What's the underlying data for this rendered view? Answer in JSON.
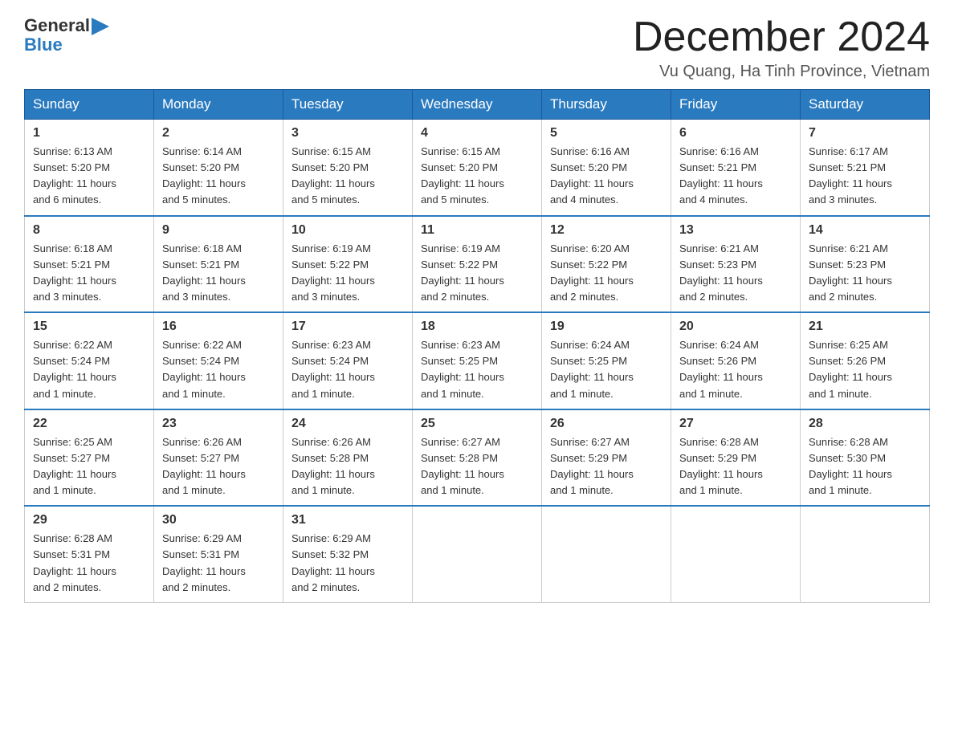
{
  "logo": {
    "text_general": "General",
    "text_blue": "Blue"
  },
  "header": {
    "month_year": "December 2024",
    "location": "Vu Quang, Ha Tinh Province, Vietnam"
  },
  "days_of_week": [
    "Sunday",
    "Monday",
    "Tuesday",
    "Wednesday",
    "Thursday",
    "Friday",
    "Saturday"
  ],
  "weeks": [
    [
      {
        "day": "1",
        "sunrise": "6:13 AM",
        "sunset": "5:20 PM",
        "daylight": "11 hours and 6 minutes."
      },
      {
        "day": "2",
        "sunrise": "6:14 AM",
        "sunset": "5:20 PM",
        "daylight": "11 hours and 5 minutes."
      },
      {
        "day": "3",
        "sunrise": "6:15 AM",
        "sunset": "5:20 PM",
        "daylight": "11 hours and 5 minutes."
      },
      {
        "day": "4",
        "sunrise": "6:15 AM",
        "sunset": "5:20 PM",
        "daylight": "11 hours and 5 minutes."
      },
      {
        "day": "5",
        "sunrise": "6:16 AM",
        "sunset": "5:20 PM",
        "daylight": "11 hours and 4 minutes."
      },
      {
        "day": "6",
        "sunrise": "6:16 AM",
        "sunset": "5:21 PM",
        "daylight": "11 hours and 4 minutes."
      },
      {
        "day": "7",
        "sunrise": "6:17 AM",
        "sunset": "5:21 PM",
        "daylight": "11 hours and 3 minutes."
      }
    ],
    [
      {
        "day": "8",
        "sunrise": "6:18 AM",
        "sunset": "5:21 PM",
        "daylight": "11 hours and 3 minutes."
      },
      {
        "day": "9",
        "sunrise": "6:18 AM",
        "sunset": "5:21 PM",
        "daylight": "11 hours and 3 minutes."
      },
      {
        "day": "10",
        "sunrise": "6:19 AM",
        "sunset": "5:22 PM",
        "daylight": "11 hours and 3 minutes."
      },
      {
        "day": "11",
        "sunrise": "6:19 AM",
        "sunset": "5:22 PM",
        "daylight": "11 hours and 2 minutes."
      },
      {
        "day": "12",
        "sunrise": "6:20 AM",
        "sunset": "5:22 PM",
        "daylight": "11 hours and 2 minutes."
      },
      {
        "day": "13",
        "sunrise": "6:21 AM",
        "sunset": "5:23 PM",
        "daylight": "11 hours and 2 minutes."
      },
      {
        "day": "14",
        "sunrise": "6:21 AM",
        "sunset": "5:23 PM",
        "daylight": "11 hours and 2 minutes."
      }
    ],
    [
      {
        "day": "15",
        "sunrise": "6:22 AM",
        "sunset": "5:24 PM",
        "daylight": "11 hours and 1 minute."
      },
      {
        "day": "16",
        "sunrise": "6:22 AM",
        "sunset": "5:24 PM",
        "daylight": "11 hours and 1 minute."
      },
      {
        "day": "17",
        "sunrise": "6:23 AM",
        "sunset": "5:24 PM",
        "daylight": "11 hours and 1 minute."
      },
      {
        "day": "18",
        "sunrise": "6:23 AM",
        "sunset": "5:25 PM",
        "daylight": "11 hours and 1 minute."
      },
      {
        "day": "19",
        "sunrise": "6:24 AM",
        "sunset": "5:25 PM",
        "daylight": "11 hours and 1 minute."
      },
      {
        "day": "20",
        "sunrise": "6:24 AM",
        "sunset": "5:26 PM",
        "daylight": "11 hours and 1 minute."
      },
      {
        "day": "21",
        "sunrise": "6:25 AM",
        "sunset": "5:26 PM",
        "daylight": "11 hours and 1 minute."
      }
    ],
    [
      {
        "day": "22",
        "sunrise": "6:25 AM",
        "sunset": "5:27 PM",
        "daylight": "11 hours and 1 minute."
      },
      {
        "day": "23",
        "sunrise": "6:26 AM",
        "sunset": "5:27 PM",
        "daylight": "11 hours and 1 minute."
      },
      {
        "day": "24",
        "sunrise": "6:26 AM",
        "sunset": "5:28 PM",
        "daylight": "11 hours and 1 minute."
      },
      {
        "day": "25",
        "sunrise": "6:27 AM",
        "sunset": "5:28 PM",
        "daylight": "11 hours and 1 minute."
      },
      {
        "day": "26",
        "sunrise": "6:27 AM",
        "sunset": "5:29 PM",
        "daylight": "11 hours and 1 minute."
      },
      {
        "day": "27",
        "sunrise": "6:28 AM",
        "sunset": "5:29 PM",
        "daylight": "11 hours and 1 minute."
      },
      {
        "day": "28",
        "sunrise": "6:28 AM",
        "sunset": "5:30 PM",
        "daylight": "11 hours and 1 minute."
      }
    ],
    [
      {
        "day": "29",
        "sunrise": "6:28 AM",
        "sunset": "5:31 PM",
        "daylight": "11 hours and 2 minutes."
      },
      {
        "day": "30",
        "sunrise": "6:29 AM",
        "sunset": "5:31 PM",
        "daylight": "11 hours and 2 minutes."
      },
      {
        "day": "31",
        "sunrise": "6:29 AM",
        "sunset": "5:32 PM",
        "daylight": "11 hours and 2 minutes."
      },
      null,
      null,
      null,
      null
    ]
  ],
  "labels": {
    "sunrise": "Sunrise:",
    "sunset": "Sunset:",
    "daylight": "Daylight:"
  }
}
